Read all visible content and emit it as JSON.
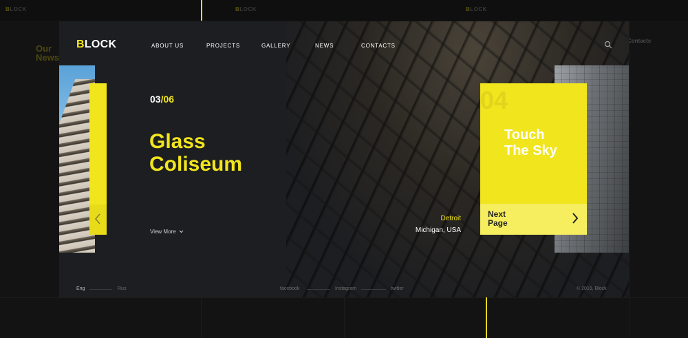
{
  "brand": {
    "logo_first": "B",
    "logo_rest": "LOCK"
  },
  "nav": {
    "items": [
      "ABOUT US",
      "PROJECTS",
      "GALLERY",
      "NEWS",
      "CONTACTS"
    ]
  },
  "slide": {
    "current": "03",
    "separator": "/",
    "total": "06",
    "title_line1": "Glass",
    "title_line2": "Coliseum",
    "view_more": "View More",
    "location_city": "Detroit",
    "location_state": "Michigan, USA"
  },
  "next_card": {
    "ghost_number": "04",
    "title_line1": "Touch",
    "title_line2": "The Sky",
    "label_line1": "Next",
    "label_line2": "Page"
  },
  "footer": {
    "lang_active": "Eng",
    "lang_other": "Rus",
    "social": [
      "facebook",
      "Instagram",
      "twitter"
    ],
    "copyright": "© 2016, Block"
  },
  "background_page": {
    "logo_first": "B",
    "logo_rest": "LOCK",
    "section_title_line1": "Our",
    "section_title_line2": "News",
    "contacts_title": "Contacts"
  },
  "colors": {
    "accent": "#f1e51d",
    "window_bg": "#1d1e21",
    "page_bg": "#131313"
  },
  "icons": {
    "search": "search-icon",
    "prev": "chevron-left-icon",
    "next": "chevron-right-icon",
    "view_more": "chevron-down-icon"
  }
}
